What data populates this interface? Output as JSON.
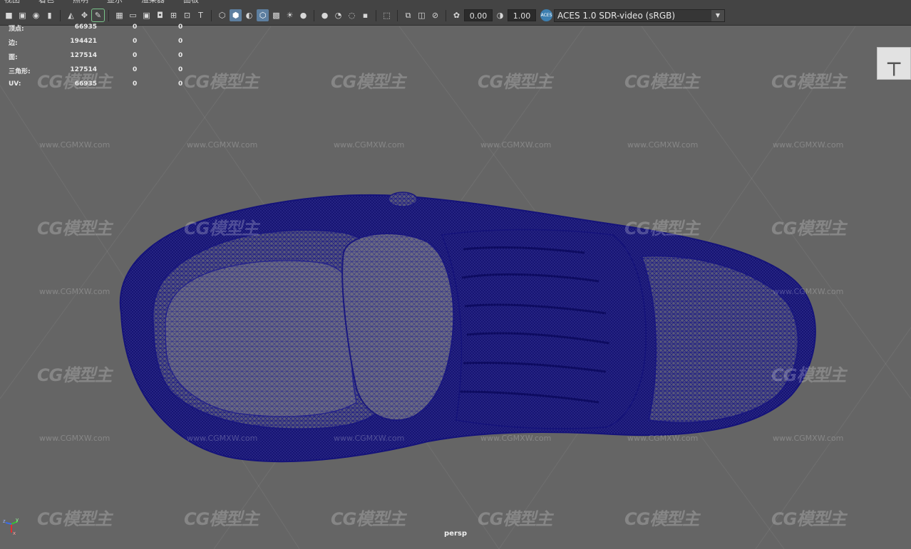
{
  "menu": {
    "items": [
      "视图",
      "着色",
      "照明",
      "显示",
      "渲染器",
      "面板"
    ]
  },
  "toolbar": {
    "gamma_value": "0.00",
    "exposure_value": "1.00",
    "color_badge": "ACES",
    "color_transform": "ACES 1.0 SDR-video (sRGB)"
  },
  "hud": {
    "rows": [
      {
        "label": "顶点:",
        "value": "66935",
        "selected": "0",
        "tri": "0"
      },
      {
        "label": "边:",
        "value": "194421",
        "selected": "0",
        "tri": "0"
      },
      {
        "label": "面:",
        "value": "127514",
        "selected": "0",
        "tri": "0"
      },
      {
        "label": "三角形:",
        "value": "127514",
        "selected": "0",
        "tri": "0"
      },
      {
        "label": "UV:",
        "value": "66935",
        "selected": "0",
        "tri": "0"
      }
    ]
  },
  "viewport": {
    "camera_label": "persp",
    "background_color": "#656565",
    "wireframe_color": "#1b1a7a",
    "watermark_logo": "CG模型主",
    "watermark_url": "www.CGMXW.com"
  },
  "axis": {
    "x": "x",
    "y": "y",
    "z": "z"
  }
}
